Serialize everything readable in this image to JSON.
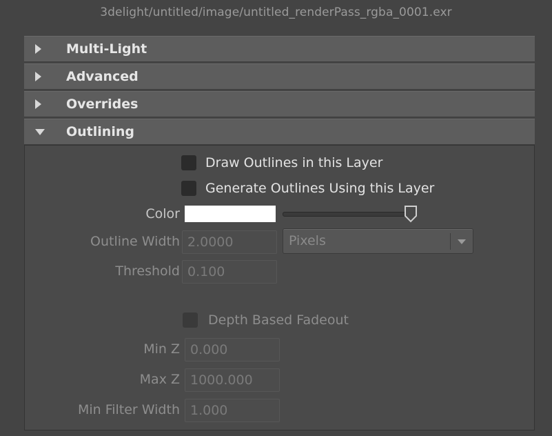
{
  "header": {
    "path": "3delight/untitled/image/untitled_renderPass_rgba_0001.exr"
  },
  "sections": [
    {
      "label": "Multi-Light",
      "expanded": false
    },
    {
      "label": "Advanced",
      "expanded": false
    },
    {
      "label": "Overrides",
      "expanded": false
    },
    {
      "label": "Outlining",
      "expanded": true
    }
  ],
  "outlining": {
    "draw_outlines_label": "Draw Outlines in this Layer",
    "draw_outlines_checked": false,
    "generate_outlines_label": "Generate Outlines Using this Layer",
    "generate_outlines_checked": false,
    "color_label": "Color",
    "color_value": "#ffffff",
    "color_slider_value": 1.0,
    "outline_width_label": "Outline Width",
    "outline_width_value": "2.0000",
    "outline_width_unit": "Pixels",
    "threshold_label": "Threshold",
    "threshold_value": "0.100",
    "depth_fadeout_label": "Depth Based Fadeout",
    "depth_fadeout_checked": false,
    "min_z_label": "Min Z",
    "min_z_value": "0.000",
    "max_z_label": "Max Z",
    "max_z_value": "1000.000",
    "min_filter_width_label": "Min Filter Width",
    "min_filter_width_value": "1.000"
  }
}
